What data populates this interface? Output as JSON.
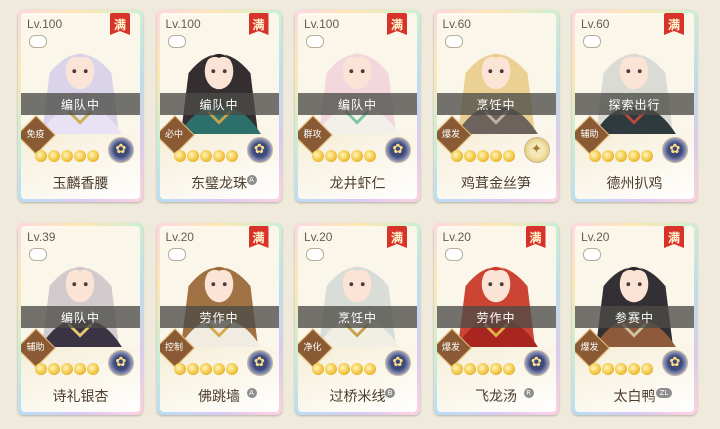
{
  "colors": {
    "status_bar": "#4b4b46",
    "max_badge": "#d8332a",
    "role_badge": "#8a5a34",
    "star": "#f1c13b",
    "name_text": "#4c3d2e"
  },
  "cards": [
    {
      "level": "Lv.100",
      "max": "满",
      "status": "编队中",
      "role": "免疫",
      "name": "玉麟香腰",
      "element_icon": "flower-icon",
      "portrait": {
        "hair": "#d8d2ea",
        "robe": "#e9e2f4",
        "accent": "#c9b04d"
      }
    },
    {
      "level": "Lv.100",
      "max": "满",
      "status": "编队中",
      "role": "必中",
      "name": "东璧龙珠",
      "element_icon": "flower-icon",
      "extra": "A",
      "portrait": {
        "hair": "#2a2326",
        "robe": "#2d6f6a",
        "accent": "#c7a24b"
      }
    },
    {
      "level": "Lv.100",
      "max": "满",
      "status": "编队中",
      "role": "群攻",
      "name": "龙井虾仁",
      "element_icon": "flower-icon",
      "portrait": {
        "hair": "#f1d6dc",
        "robe": "#f3f0ea",
        "accent": "#7fc59e"
      }
    },
    {
      "level": "Lv.60",
      "max": "",
      "status": "烹饪中",
      "role": "爆发",
      "name": "鸡茸金丝笋",
      "element_icon": "leaf-icon",
      "portrait": {
        "hair": "#e9cf8e",
        "robe": "#6e625c",
        "accent": "#bfb2a0"
      }
    },
    {
      "level": "Lv.60",
      "max": "满",
      "status": "探索出行",
      "role": "辅助",
      "name": "德州扒鸡",
      "element_icon": "flower-icon",
      "portrait": {
        "hair": "#d9d9d5",
        "robe": "#2f3a3f",
        "accent": "#b64a3b"
      }
    },
    {
      "level": "Lv.39",
      "max": "",
      "status": "编队中",
      "role": "辅助",
      "name": "诗礼银杏",
      "element_icon": "flower-icon",
      "portrait": {
        "hair": "#cfc8cc",
        "robe": "#3a3343",
        "accent": "#e7c96c"
      }
    },
    {
      "level": "Lv.20",
      "max": "满",
      "status": "劳作中",
      "role": "控制",
      "name": "佛跳墙",
      "element_icon": "flower-icon",
      "extra": "A",
      "portrait": {
        "hair": "#9b6a3a",
        "robe": "#f0ece2",
        "accent": "#d6a84e"
      }
    },
    {
      "level": "Lv.20",
      "max": "满",
      "status": "烹饪中",
      "role": "净化",
      "name": "过桥米线",
      "element_icon": "flower-icon",
      "extra": "B",
      "portrait": {
        "hair": "#d6dcd6",
        "robe": "#f1eee4",
        "accent": "#c7a24b"
      }
    },
    {
      "level": "Lv.20",
      "max": "满",
      "status": "劳作中",
      "role": "爆发",
      "name": "飞龙汤",
      "element_icon": "flower-icon",
      "extra": "R",
      "portrait": {
        "hair": "#c93a2a",
        "robe": "#a8261f",
        "accent": "#e2b04a"
      }
    },
    {
      "level": "Lv.20",
      "max": "满",
      "status": "参赛中",
      "role": "爆发",
      "name": "太白鸭",
      "element_icon": "flower-icon",
      "extra": "ZL",
      "portrait": {
        "hair": "#27252a",
        "robe": "#8f5a3a",
        "accent": "#d2c3a0"
      }
    }
  ]
}
